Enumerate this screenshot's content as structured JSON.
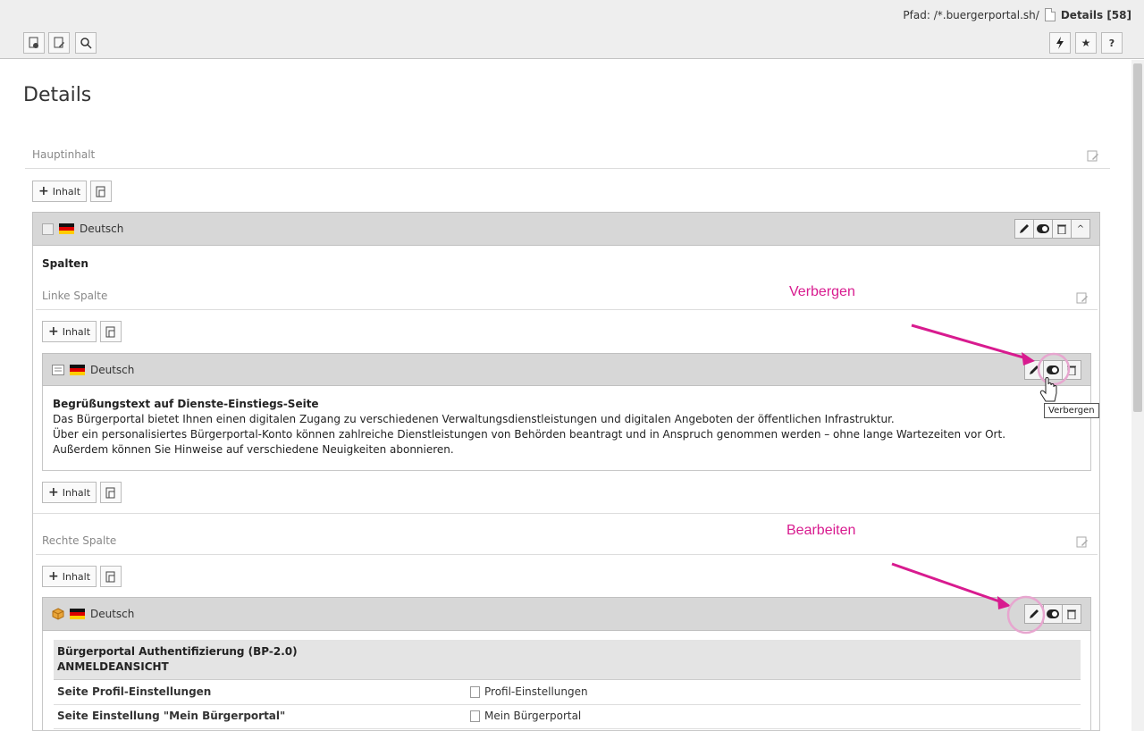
{
  "path": {
    "prefix": "Pfad: /*.buergerportal.sh/",
    "current": "Details [58]"
  },
  "page_title": "Details",
  "main_column": {
    "label": "Hauptinhalt"
  },
  "buttons": {
    "add_content": "Inhalt"
  },
  "language": "Deutsch",
  "columns_title": "Spalten",
  "left_column": {
    "label": "Linke Spalte",
    "element": {
      "title": "Begrüßungstext auf Dienste-Einstiegs-Seite",
      "lines": [
        "Das Bürgerportal bietet Ihnen einen digitalen Zugang zu verschiedenen Verwaltungsdienstleistungen und digitalen Angeboten der öffentlichen Infrastruktur.",
        "Über ein personalisiertes Bürgerportal-Konto können zahlreiche Dienstleistungen von Behörden beantragt und in Anspruch genommen werden – ohne lange Wartezeiten vor Ort.",
        "Außerdem können Sie Hinweise auf verschiedene Neuigkeiten abonnieren."
      ]
    }
  },
  "right_column": {
    "label": "Rechte Spalte",
    "plugin": {
      "title_line1": "Bürgerportal Authentifizierung (BP-2.0)",
      "title_line2": "ANMELDEANSICHT",
      "rows": [
        {
          "label": "Seite Profil-Einstellungen",
          "value": "Profil-Einstellungen"
        },
        {
          "label": "Seite Einstellung \"Mein Bürgerportal\"",
          "value": "Mein Bürgerportal"
        }
      ]
    }
  },
  "annotations": {
    "hide": "Verbergen",
    "edit": "Bearbeiten",
    "tooltip": "Verbergen"
  },
  "colors": {
    "annotation": "#d81b8f",
    "header_bg": "#eeeeee",
    "ce_header": "#d7d7d7"
  }
}
